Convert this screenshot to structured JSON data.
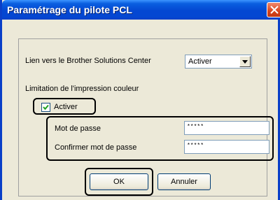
{
  "window": {
    "title": "Paramétrage du pilote PCL",
    "close_icon": "close-icon"
  },
  "solutions_center": {
    "label": "Lien vers le Brother Solutions Center",
    "selected": "Activer"
  },
  "color_limit": {
    "label": "Limitation de l'impression couleur",
    "checkbox_label": "Activer",
    "checked": true,
    "password_label": "Mot de passe",
    "password_value": "*****",
    "confirm_label": "Confirmer mot de passe",
    "confirm_value": "*****"
  },
  "buttons": {
    "ok": "OK",
    "cancel": "Annuler"
  },
  "colors": {
    "titlebar": "#0447d2",
    "dialog_bg": "#ece9d8",
    "close_button": "#d9441c"
  }
}
